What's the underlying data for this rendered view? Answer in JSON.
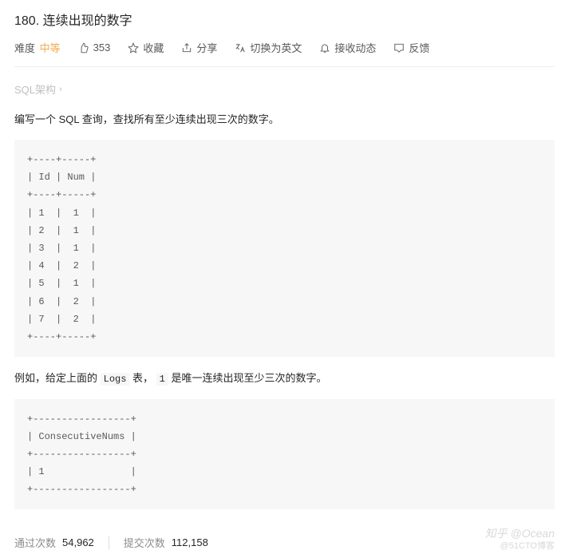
{
  "title": "180. 连续出现的数字",
  "toolbar": {
    "difficulty_label": "难度",
    "difficulty_level": "中等",
    "likes": "353",
    "favorite": "收藏",
    "share": "分享",
    "translate": "切换为英文",
    "subscribe": "接收动态",
    "feedback": "反馈"
  },
  "schema_link": "SQL架构",
  "description": "编写一个 SQL 查询，查找所有至少连续出现三次的数字。",
  "code_block_1": "+----+-----+\n| Id | Num |\n+----+-----+\n| 1  |  1  |\n| 2  |  1  |\n| 3  |  1  |\n| 4  |  2  |\n| 5  |  1  |\n| 6  |  2  |\n| 7  |  2  |\n+----+-----+",
  "example_prefix": "例如，给定上面的 ",
  "example_code1": "Logs",
  "example_mid": " 表， ",
  "example_code2": "1",
  "example_suffix": " 是唯一连续出现至少三次的数字。",
  "code_block_2": "+-----------------+\n| ConsecutiveNums |\n+-----------------+\n| 1               |\n+-----------------+",
  "stats": {
    "accepted_label": "通过次数",
    "accepted_value": "54,962",
    "submitted_label": "提交次数",
    "submitted_value": "112,158"
  },
  "watermark": {
    "line1": "知乎 @Ocean",
    "line2": "@51CTO博客"
  }
}
